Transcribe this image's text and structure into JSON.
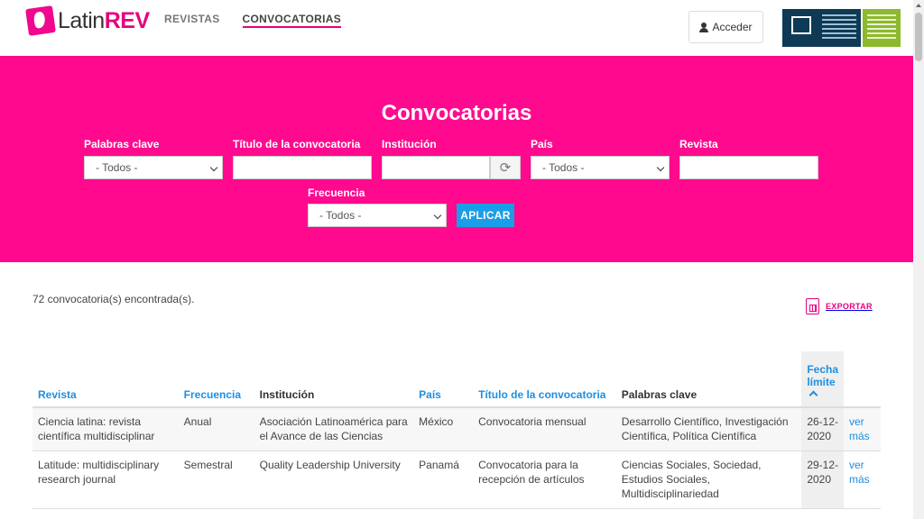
{
  "brand": {
    "prefix": "Latin",
    "suffix": "REV"
  },
  "nav": {
    "items": [
      "REVISTAS",
      "CONVOCATORIAS"
    ],
    "active": "CONVOCATORIAS"
  },
  "login": {
    "label": "Acceder"
  },
  "hero": {
    "title": "Convocatorias",
    "filters": {
      "keywords": {
        "label": "Palabras clave",
        "value": "- Todos -"
      },
      "call_title": {
        "label": "Título de la convocatoria",
        "value": ""
      },
      "institution": {
        "label": "Institución",
        "value": ""
      },
      "country": {
        "label": "País",
        "value": "- Todos -"
      },
      "journal": {
        "label": "Revista",
        "value": ""
      },
      "frequency": {
        "label": "Frecuencia",
        "value": "- Todos -"
      }
    },
    "apply_label": "APLICAR"
  },
  "results": {
    "count_text": "72 convocatoria(s) encontrada(s).",
    "export_label": "EXPORTAR",
    "columns": [
      "Revista",
      "Frecuencia",
      "Institución",
      "País",
      "Título de la convocatoria",
      "Palabras clave",
      "Fecha límite"
    ],
    "rows": [
      {
        "revista": "Ciencia latina: revista científica multidisciplinar",
        "frecuencia": "Anual",
        "institucion": "Asociación Latinoamérica para el Avance de las Ciencias",
        "pais": "México",
        "titulo": "Convocatoria mensual",
        "palabras": "Desarrollo Científico, Investigación Científica, Política Científica",
        "fecha": "26-12-2020",
        "link": "ver más"
      },
      {
        "revista": "Latitude: multidisciplinary research journal",
        "frecuencia": "Semestral",
        "institucion": "Quality Leadership University",
        "pais": "Panamá",
        "titulo": "Convocatoria para la recepción de artículos",
        "palabras": "Ciencias Sociales, Sociedad, Estudios Sociales, Multidisciplinariedad",
        "fecha": "29-12-2020",
        "link": "ver más"
      }
    ]
  },
  "colors": {
    "accent": "#ff0a8f",
    "brand_pink": "#e6007e",
    "link_blue": "#1f8ee0",
    "button_blue": "#1a9ee8"
  }
}
